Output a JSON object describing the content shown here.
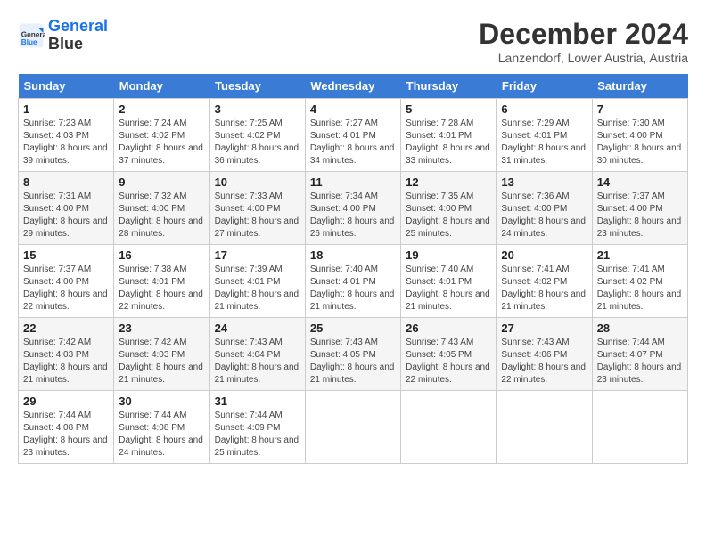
{
  "logo": {
    "line1": "General",
    "line2": "Blue"
  },
  "title": "December 2024",
  "location": "Lanzendorf, Lower Austria, Austria",
  "weekdays": [
    "Sunday",
    "Monday",
    "Tuesday",
    "Wednesday",
    "Thursday",
    "Friday",
    "Saturday"
  ],
  "weeks": [
    [
      {
        "day": 1,
        "sunrise": "7:23 AM",
        "sunset": "4:03 PM",
        "daylight": "8 hours and 39 minutes."
      },
      {
        "day": 2,
        "sunrise": "7:24 AM",
        "sunset": "4:02 PM",
        "daylight": "8 hours and 37 minutes."
      },
      {
        "day": 3,
        "sunrise": "7:25 AM",
        "sunset": "4:02 PM",
        "daylight": "8 hours and 36 minutes."
      },
      {
        "day": 4,
        "sunrise": "7:27 AM",
        "sunset": "4:01 PM",
        "daylight": "8 hours and 34 minutes."
      },
      {
        "day": 5,
        "sunrise": "7:28 AM",
        "sunset": "4:01 PM",
        "daylight": "8 hours and 33 minutes."
      },
      {
        "day": 6,
        "sunrise": "7:29 AM",
        "sunset": "4:01 PM",
        "daylight": "8 hours and 31 minutes."
      },
      {
        "day": 7,
        "sunrise": "7:30 AM",
        "sunset": "4:00 PM",
        "daylight": "8 hours and 30 minutes."
      }
    ],
    [
      {
        "day": 8,
        "sunrise": "7:31 AM",
        "sunset": "4:00 PM",
        "daylight": "8 hours and 29 minutes."
      },
      {
        "day": 9,
        "sunrise": "7:32 AM",
        "sunset": "4:00 PM",
        "daylight": "8 hours and 28 minutes."
      },
      {
        "day": 10,
        "sunrise": "7:33 AM",
        "sunset": "4:00 PM",
        "daylight": "8 hours and 27 minutes."
      },
      {
        "day": 11,
        "sunrise": "7:34 AM",
        "sunset": "4:00 PM",
        "daylight": "8 hours and 26 minutes."
      },
      {
        "day": 12,
        "sunrise": "7:35 AM",
        "sunset": "4:00 PM",
        "daylight": "8 hours and 25 minutes."
      },
      {
        "day": 13,
        "sunrise": "7:36 AM",
        "sunset": "4:00 PM",
        "daylight": "8 hours and 24 minutes."
      },
      {
        "day": 14,
        "sunrise": "7:37 AM",
        "sunset": "4:00 PM",
        "daylight": "8 hours and 23 minutes."
      }
    ],
    [
      {
        "day": 15,
        "sunrise": "7:37 AM",
        "sunset": "4:00 PM",
        "daylight": "8 hours and 22 minutes."
      },
      {
        "day": 16,
        "sunrise": "7:38 AM",
        "sunset": "4:01 PM",
        "daylight": "8 hours and 22 minutes."
      },
      {
        "day": 17,
        "sunrise": "7:39 AM",
        "sunset": "4:01 PM",
        "daylight": "8 hours and 21 minutes."
      },
      {
        "day": 18,
        "sunrise": "7:40 AM",
        "sunset": "4:01 PM",
        "daylight": "8 hours and 21 minutes."
      },
      {
        "day": 19,
        "sunrise": "7:40 AM",
        "sunset": "4:01 PM",
        "daylight": "8 hours and 21 minutes."
      },
      {
        "day": 20,
        "sunrise": "7:41 AM",
        "sunset": "4:02 PM",
        "daylight": "8 hours and 21 minutes."
      },
      {
        "day": 21,
        "sunrise": "7:41 AM",
        "sunset": "4:02 PM",
        "daylight": "8 hours and 21 minutes."
      }
    ],
    [
      {
        "day": 22,
        "sunrise": "7:42 AM",
        "sunset": "4:03 PM",
        "daylight": "8 hours and 21 minutes."
      },
      {
        "day": 23,
        "sunrise": "7:42 AM",
        "sunset": "4:03 PM",
        "daylight": "8 hours and 21 minutes."
      },
      {
        "day": 24,
        "sunrise": "7:43 AM",
        "sunset": "4:04 PM",
        "daylight": "8 hours and 21 minutes."
      },
      {
        "day": 25,
        "sunrise": "7:43 AM",
        "sunset": "4:05 PM",
        "daylight": "8 hours and 21 minutes."
      },
      {
        "day": 26,
        "sunrise": "7:43 AM",
        "sunset": "4:05 PM",
        "daylight": "8 hours and 22 minutes."
      },
      {
        "day": 27,
        "sunrise": "7:43 AM",
        "sunset": "4:06 PM",
        "daylight": "8 hours and 22 minutes."
      },
      {
        "day": 28,
        "sunrise": "7:44 AM",
        "sunset": "4:07 PM",
        "daylight": "8 hours and 23 minutes."
      }
    ],
    [
      {
        "day": 29,
        "sunrise": "7:44 AM",
        "sunset": "4:08 PM",
        "daylight": "8 hours and 23 minutes."
      },
      {
        "day": 30,
        "sunrise": "7:44 AM",
        "sunset": "4:08 PM",
        "daylight": "8 hours and 24 minutes."
      },
      {
        "day": 31,
        "sunrise": "7:44 AM",
        "sunset": "4:09 PM",
        "daylight": "8 hours and 25 minutes."
      },
      null,
      null,
      null,
      null
    ]
  ]
}
